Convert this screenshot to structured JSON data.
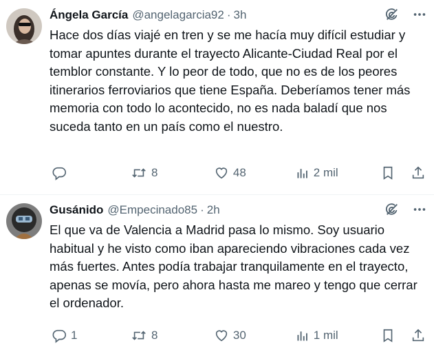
{
  "tweets": [
    {
      "name": "Ángela García",
      "handle": "@angelagarcia92",
      "separator": "·",
      "time": "3h",
      "text": "Hace dos días viajé en tren y se me hacía muy difícil estudiar y tomar apuntes durante el trayecto Alicante-Ciudad Real por el temblor constante. Y lo peor de todo, que no es de los peores itinerarios ferroviarios que tiene España. Deberíamos tener más memoria con todo lo acontecido, no es nada baladí que nos suceda tanto en un país como el nuestro.",
      "replies": "",
      "retweets": "8",
      "likes": "48",
      "views": "2 mil"
    },
    {
      "name": "Gusánido",
      "handle": "@Empecinado85",
      "separator": "·",
      "time": "2h",
      "text": "El que va de Valencia a Madrid pasa lo mismo. Soy usuario habitual y he visto como iban apareciendo vibraciones cada vez más fuertes. Antes podía trabajar tranquilamente en el trayecto, apenas se movía, pero ahora hasta me mareo y tengo que cerrar el ordenador.",
      "replies": "1",
      "retweets": "8",
      "likes": "30",
      "views": "1 mil"
    }
  ],
  "icons": {
    "grok": "grok-icon",
    "more": "more-icon",
    "reply": "reply-icon",
    "retweet": "retweet-icon",
    "like": "heart-icon",
    "views": "views-icon",
    "bookmark": "bookmark-icon",
    "share": "share-icon"
  },
  "colors": {
    "text": "#0f1419",
    "muted": "#536471",
    "divider": "#eff3f4"
  }
}
